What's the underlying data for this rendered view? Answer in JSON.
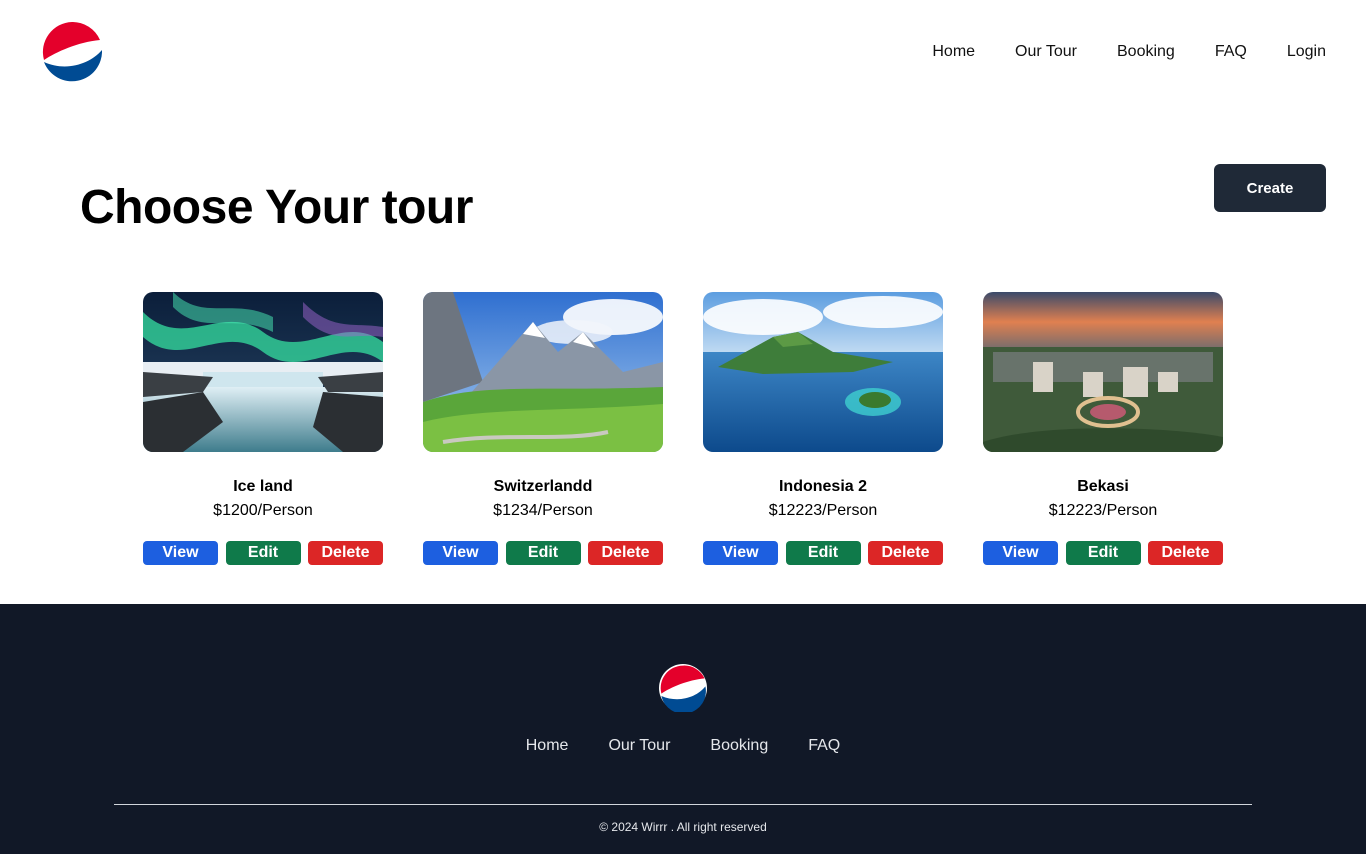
{
  "header": {
    "logo_icon": "pepsi-globe-logo",
    "nav": [
      {
        "label": "Home"
      },
      {
        "label": "Our Tour"
      },
      {
        "label": "Booking"
      },
      {
        "label": "FAQ"
      },
      {
        "label": "Login"
      }
    ]
  },
  "main": {
    "title": "Choose Your tour",
    "create_label": "Create",
    "tours": [
      {
        "name": "Ice land",
        "price": "$1200/Person",
        "image": "aurora-waterfall",
        "view_label": "View",
        "edit_label": "Edit",
        "delete_label": "Delete"
      },
      {
        "name": "Switzerlandd",
        "price": "$1234/Person",
        "image": "alpine-valley",
        "view_label": "View",
        "edit_label": "Edit",
        "delete_label": "Delete"
      },
      {
        "name": "Indonesia 2",
        "price": "$12223/Person",
        "image": "tropical-island",
        "view_label": "View",
        "edit_label": "Edit",
        "delete_label": "Delete"
      },
      {
        "name": "Bekasi",
        "price": "$12223/Person",
        "image": "city-roundabout-sunset",
        "view_label": "View",
        "edit_label": "Edit",
        "delete_label": "Delete"
      }
    ]
  },
  "footer": {
    "logo_icon": "pepsi-globe-logo",
    "nav": [
      {
        "label": "Home"
      },
      {
        "label": "Our Tour"
      },
      {
        "label": "Booking"
      },
      {
        "label": "FAQ"
      }
    ],
    "copyright": "© 2024 Wirrr . All right reserved"
  },
  "colors": {
    "create_button": "#1f2937",
    "view_button": "#1d5fe0",
    "edit_button": "#0f7a4a",
    "delete_button": "#dc2626",
    "footer_bg": "#111827"
  }
}
